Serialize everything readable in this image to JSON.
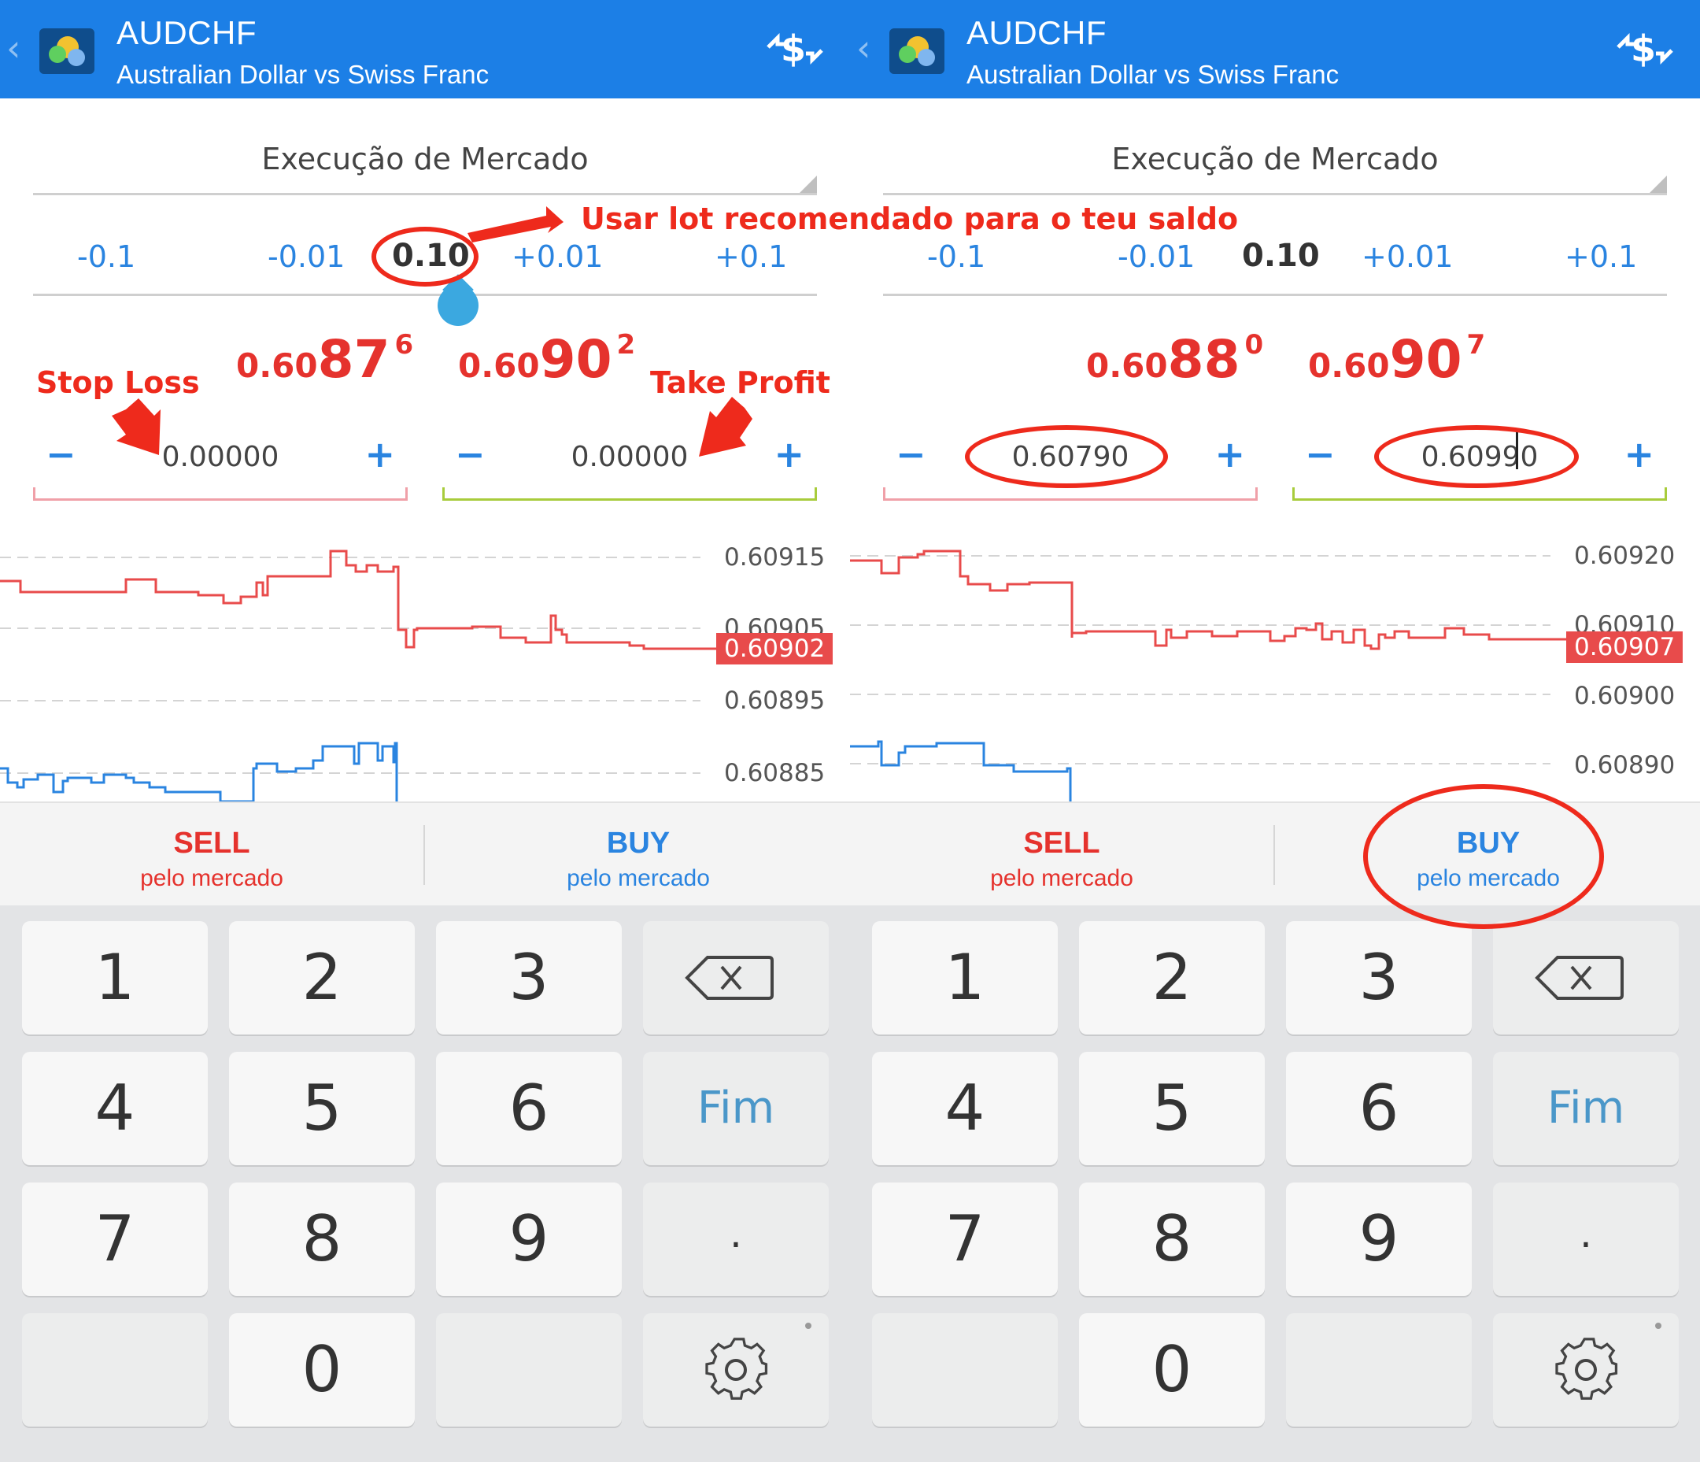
{
  "panels": [
    {
      "header": {
        "symbol": "AUDCHF",
        "description": "Australian Dollar vs Swiss Franc"
      },
      "execution": "Execução de Mercado",
      "volume": {
        "minus_big": "-0.1",
        "minus_small": "-0.01",
        "value": "0.10",
        "plus_small": "+0.01",
        "plus_big": "+0.1"
      },
      "bid": {
        "prefix": "0.60",
        "big": "87",
        "sup": "6"
      },
      "ask": {
        "prefix": "0.60",
        "big": "90",
        "sup": "2"
      },
      "sl": {
        "minus": "−",
        "value": "0.00000",
        "plus": "+"
      },
      "tp": {
        "minus": "−",
        "value": "0.00000",
        "plus": "+"
      },
      "chart": {
        "labels": [
          "0.60915",
          "0.60905",
          "0.60895",
          "0.60885"
        ],
        "current": "0.60902"
      },
      "sell": {
        "label": "SELL",
        "sub": "pelo mercado"
      },
      "buy": {
        "label": "BUY",
        "sub": "pelo mercado"
      }
    },
    {
      "header": {
        "symbol": "AUDCHF",
        "description": "Australian Dollar vs Swiss Franc"
      },
      "execution": "Execução de Mercado",
      "volume": {
        "minus_big": "-0.1",
        "minus_small": "-0.01",
        "value": "0.10",
        "plus_small": "+0.01",
        "plus_big": "+0.1"
      },
      "bid": {
        "prefix": "0.60",
        "big": "88",
        "sup": "0"
      },
      "ask": {
        "prefix": "0.60",
        "big": "90",
        "sup": "7"
      },
      "sl": {
        "minus": "−",
        "value": "0.60790",
        "plus": "+"
      },
      "tp": {
        "minus": "−",
        "value": "0.60990",
        "plus": "+"
      },
      "chart": {
        "labels": [
          "0.60920",
          "0.60910",
          "0.60900",
          "0.60890"
        ],
        "current": "0.60907"
      },
      "sell": {
        "label": "SELL",
        "sub": "pelo mercado"
      },
      "buy": {
        "label": "BUY",
        "sub": "pelo mercado"
      }
    }
  ],
  "keypad": {
    "k1": "1",
    "k2": "2",
    "k3": "3",
    "k4": "4",
    "k5": "5",
    "k6": "6",
    "k7": "7",
    "k8": "8",
    "k9": "9",
    "k0": "0",
    "fim": "Fim",
    "dot": "."
  },
  "annotations": {
    "lot": "Usar lot recomendado para o teu saldo",
    "stop_loss": "Stop Loss",
    "take_profit": "Take Profit"
  },
  "colors": {
    "header": "#1c7fe6",
    "sell": "#e5322d",
    "buy": "#2a84e0",
    "annotation": "#ee2a1c"
  }
}
